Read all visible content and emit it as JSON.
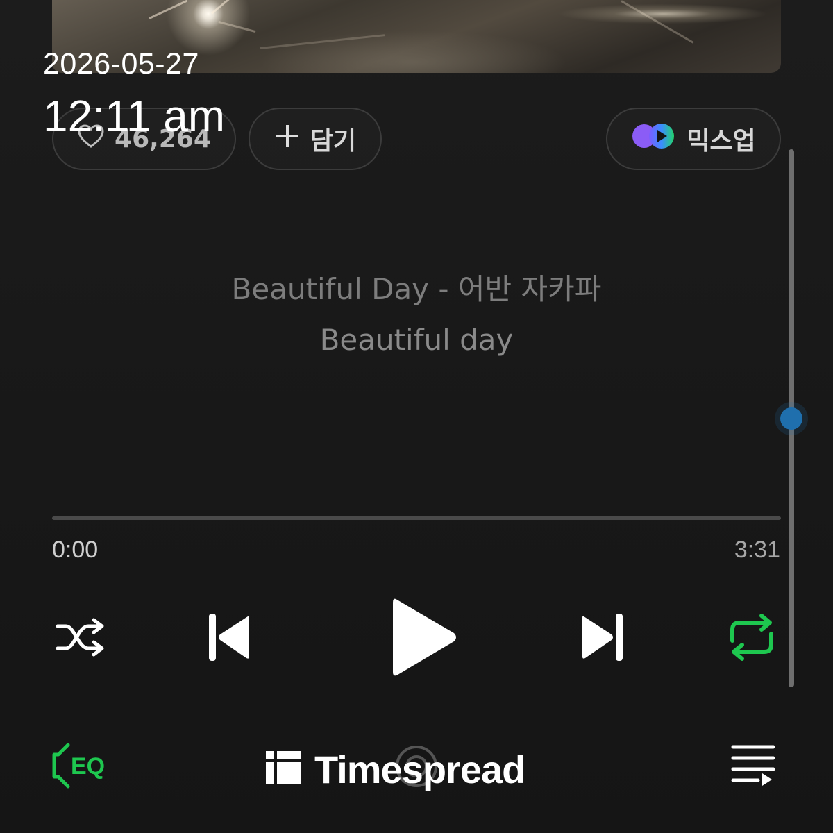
{
  "status": {
    "date": "2026-05-27",
    "time": "12:11 am"
  },
  "actions": {
    "like_count": "46,264",
    "add_label": "담기",
    "mixup_label": "믹스업"
  },
  "lyrics": {
    "line1": "Beautiful Day - 어반 자카파",
    "line2": "Beautiful day"
  },
  "player": {
    "elapsed": "0:00",
    "total": "3:31",
    "progress_fraction": 0,
    "scroll_position_fraction": 0.5,
    "shuffle_icon": "shuffle-icon",
    "prev_icon": "skip-previous-icon",
    "play_icon": "play-icon",
    "next_icon": "skip-next-icon",
    "repeat_icon": "repeat-icon",
    "repeat_active_color": "#1ec74f"
  },
  "bottom": {
    "eq_label": "EQ",
    "eq_color": "#1ec74f",
    "queue_icon": "playlist-icon",
    "watermark_text": "Timespread"
  },
  "colors": {
    "background": "#1a1a1a",
    "accent_green": "#1ec74f",
    "scroll_thumb": "#1f6fad"
  }
}
